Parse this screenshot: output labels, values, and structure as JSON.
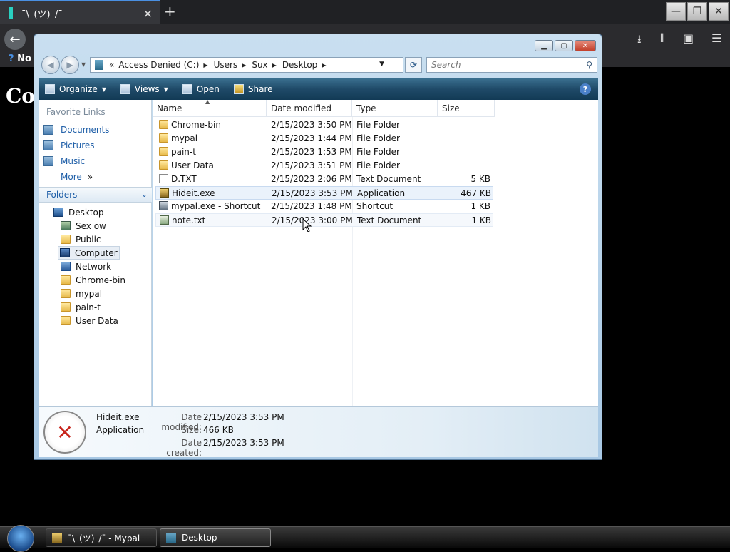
{
  "browser": {
    "tab_title": "¯\\_(ツ)_/¯",
    "tab_close": "✕",
    "new_tab": "+",
    "bookmark_item": "No",
    "page_heading": "Co"
  },
  "window_controls": {
    "minimize": "—",
    "restore": "❐",
    "close": "✕"
  },
  "explorer": {
    "breadcrumb_prefix": "«",
    "breadcrumbs": [
      "Access Denied (C:)",
      "Users",
      "Sux",
      "Desktop"
    ],
    "search_placeholder": "Search",
    "toolbar": {
      "organize": "Organize",
      "views": "Views",
      "open": "Open",
      "share": "Share",
      "help": "?"
    },
    "nav": {
      "favorite_links_heading": "Favorite Links",
      "favorite_links": [
        "Documents",
        "Pictures",
        "Music"
      ],
      "more": "More",
      "more_chevron": "»",
      "folders_label": "Folders",
      "tree": [
        "Desktop",
        "Sex ow",
        "Public",
        "Computer",
        "Network",
        "Chrome-bin",
        "mypal",
        "pain-t",
        "User Data"
      ]
    },
    "columns": [
      "Name",
      "Date modified",
      "Type",
      "Size"
    ],
    "files": [
      {
        "name": "Chrome-bin",
        "date": "2/15/2023 3:50 PM",
        "type": "File Folder",
        "size": ""
      },
      {
        "name": "mypal",
        "date": "2/15/2023 1:44 PM",
        "type": "File Folder",
        "size": ""
      },
      {
        "name": "pain-t",
        "date": "2/15/2023 1:53 PM",
        "type": "File Folder",
        "size": ""
      },
      {
        "name": "User Data",
        "date": "2/15/2023 3:51 PM",
        "type": "File Folder",
        "size": ""
      },
      {
        "name": "D.TXT",
        "date": "2/15/2023 2:06 PM",
        "type": "Text Document",
        "size": "5 KB"
      },
      {
        "name": "Hideit.exe",
        "date": "2/15/2023 3:53 PM",
        "type": "Application",
        "size": "467 KB"
      },
      {
        "name": "mypal.exe - Shortcut",
        "date": "2/15/2023 1:48 PM",
        "type": "Shortcut",
        "size": "1 KB"
      },
      {
        "name": "note.txt",
        "date": "2/15/2023 3:00 PM",
        "type": "Text Document",
        "size": "1 KB"
      }
    ],
    "details": {
      "name": "Hideit.exe",
      "type": "Application",
      "date_modified_label": "Date modified:",
      "date_modified": "2/15/2023 3:53 PM",
      "size_label": "Size:",
      "size": "466 KB",
      "date_created_label": "Date created:",
      "date_created": "2/15/2023 3:53 PM"
    }
  },
  "taskbar": {
    "items": [
      "¯\\_(ツ)_/¯ - Mypal",
      "Desktop"
    ]
  }
}
